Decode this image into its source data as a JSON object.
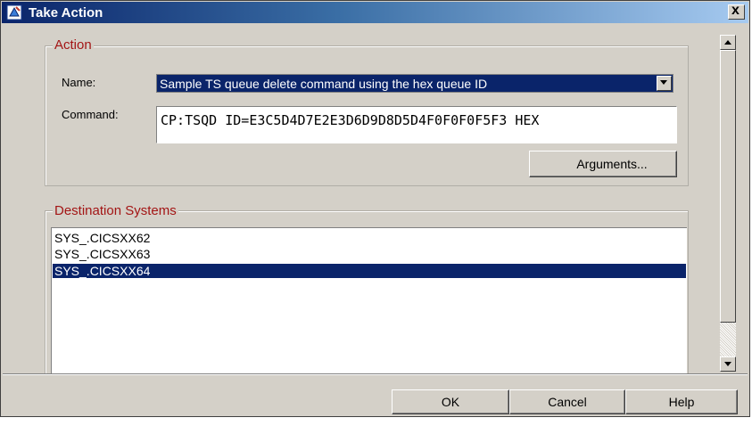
{
  "window": {
    "title": "Take Action",
    "title_icon": "take-action-icon",
    "close_label": "x"
  },
  "action_group": {
    "legend": "Action",
    "name_label": "Name:",
    "name_value": "Sample TS queue delete command using the hex queue ID",
    "command_label": "Command:",
    "command_value": "CP:TSQD ID=E3C5D4D7E2E3D6D9D8D5D4F0F0F0F5F3 HEX",
    "arguments_label": "Arguments..."
  },
  "destination_group": {
    "legend": "Destination Systems",
    "items": [
      {
        "label": "SYS_.CICSXX62",
        "selected": false
      },
      {
        "label": "SYS_.CICSXX63",
        "selected": false
      },
      {
        "label": "SYS_.CICSXX64",
        "selected": true
      }
    ]
  },
  "buttons": {
    "ok_label": "OK",
    "cancel_label": "Cancel",
    "help_label": "Help"
  },
  "colors": {
    "selection": "#0a246a",
    "legend_text": "#a31515",
    "dialog_bg": "#d4d0c8"
  }
}
